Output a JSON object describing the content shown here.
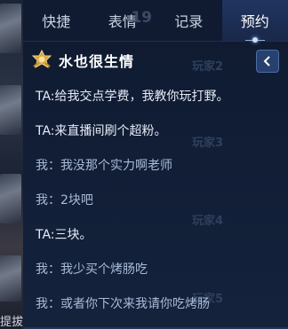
{
  "tabs": [
    {
      "label": "快捷",
      "active": false
    },
    {
      "label": "表情",
      "active": false,
      "ghost": "19"
    },
    {
      "label": "记录",
      "active": false
    },
    {
      "label": "预约",
      "active": true
    }
  ],
  "chat": {
    "contact_name": "水也很生情",
    "messages": [
      {
        "sender": "ta",
        "text": "TA:给我交点学费，我教你玩打野。"
      },
      {
        "sender": "ta",
        "text": "TA:来直播间刷个超粉。"
      },
      {
        "sender": "me",
        "text": "我：我没那个实力啊老师"
      },
      {
        "sender": "me",
        "text": "我：2块吧"
      },
      {
        "sender": "ta",
        "text": "TA:三块。"
      },
      {
        "sender": "me",
        "text": "我：我少买个烤肠吃"
      },
      {
        "sender": "me",
        "text": "我：或者你下次来我请你吃烤肠"
      }
    ]
  },
  "background": {
    "player_labels": [
      "玩家2",
      "玩家3",
      "玩家4",
      "玩家5"
    ],
    "bottom_text": "提拔"
  },
  "colors": {
    "panel": "#14223c",
    "accent": "#4d6ea8",
    "ta_text": "#e6ecf6",
    "me_text": "#a8bbd8"
  }
}
